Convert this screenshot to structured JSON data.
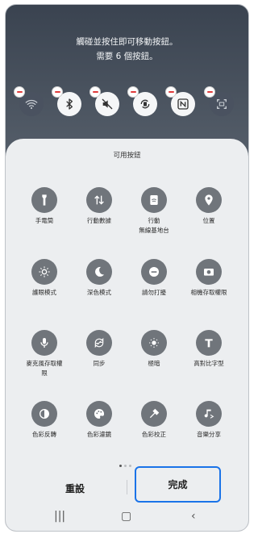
{
  "instructions": {
    "line1": "觸碰並按住即可移動按鈕。",
    "line2": "需要 6 個按鈕。"
  },
  "active_buttons": [
    {
      "icon": "wifi-icon",
      "enabled": false
    },
    {
      "icon": "bluetooth-icon",
      "enabled": true
    },
    {
      "icon": "mute-icon",
      "enabled": true
    },
    {
      "icon": "auto-rotate-icon",
      "enabled": true
    },
    {
      "icon": "nfc-icon",
      "enabled": true
    },
    {
      "icon": "screen-capture-icon",
      "enabled": false
    }
  ],
  "sheet": {
    "title": "可用按鈕",
    "items": [
      {
        "label": "手電筒",
        "icon": "flashlight-icon"
      },
      {
        "label": "行動數據",
        "icon": "mobile-data-icon"
      },
      {
        "label": "行動\n無線基地台",
        "icon": "hotspot-icon"
      },
      {
        "label": "位置",
        "icon": "location-icon"
      },
      {
        "label": "護眼模式",
        "icon": "eye-comfort-icon"
      },
      {
        "label": "深色模式",
        "icon": "dark-mode-icon"
      },
      {
        "label": "請勿打擾",
        "icon": "do-not-disturb-icon"
      },
      {
        "label": "相機存取權限",
        "icon": "camera-access-icon"
      },
      {
        "label": "麥克風存取權\n限",
        "icon": "microphone-access-icon"
      },
      {
        "label": "同步",
        "icon": "sync-icon"
      },
      {
        "label": "極暗",
        "icon": "extra-dim-icon"
      },
      {
        "label": "高對比字型",
        "icon": "high-contrast-font-icon"
      },
      {
        "label": "色彩反轉",
        "icon": "color-inversion-icon"
      },
      {
        "label": "色彩濾鏡",
        "icon": "color-filter-icon"
      },
      {
        "label": "色彩校正",
        "icon": "color-correction-icon"
      },
      {
        "label": "音樂分享",
        "icon": "music-share-icon"
      }
    ],
    "reset_label": "重設",
    "done_label": "完成"
  },
  "colors": {
    "accent": "#1a73e8",
    "icon_bg": "#70757b"
  }
}
